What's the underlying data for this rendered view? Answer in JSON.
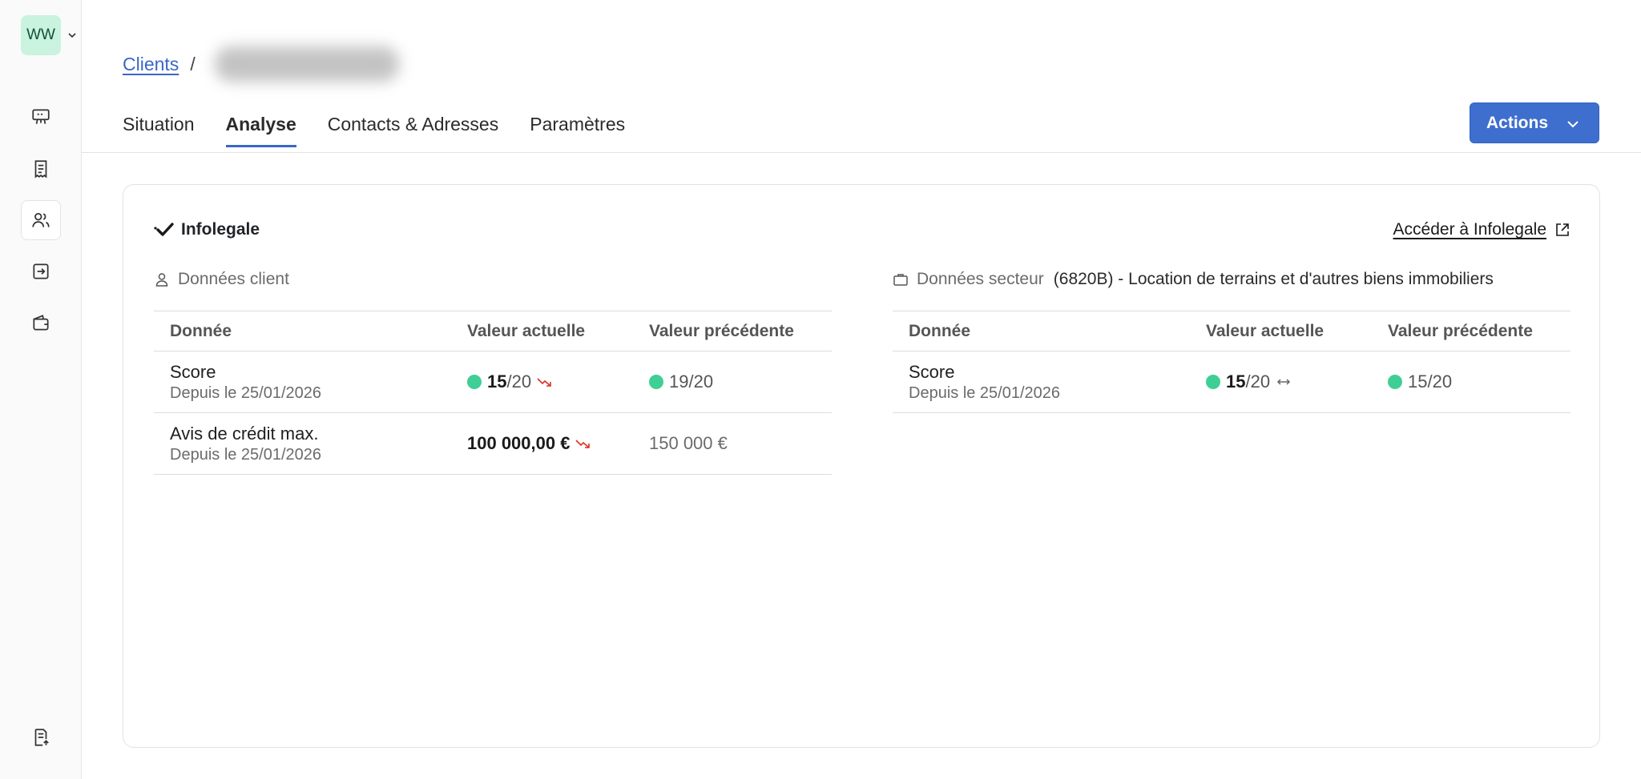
{
  "org": {
    "initials": "WW"
  },
  "breadcrumb": {
    "parent": "Clients",
    "separator": "/"
  },
  "tabs": [
    {
      "label": "Situation"
    },
    {
      "label": "Analyse"
    },
    {
      "label": "Contacts & Adresses"
    },
    {
      "label": "Paramètres"
    }
  ],
  "actions_label": "Actions",
  "card": {
    "title": "Infolegale",
    "external_link": "Accéder à Infolegale"
  },
  "client": {
    "heading": "Données client",
    "headers": [
      "Donnée",
      "Valeur actuelle",
      "Valeur précédente"
    ],
    "rows": [
      {
        "label": "Score",
        "since": "Depuis le 25/01/2026",
        "current_main": "15",
        "current_suffix": "/20",
        "trend": "down",
        "previous": "19/20"
      },
      {
        "label": "Avis de crédit max.",
        "since": "Depuis le 25/01/2026",
        "current_main": "100 000,00 €",
        "trend": "down",
        "previous": "150 000 €"
      }
    ]
  },
  "sector": {
    "heading": "Données secteur",
    "code": "(6820B) - Location de terrains et d'autres biens immobiliers",
    "headers": [
      "Donnée",
      "Valeur actuelle",
      "Valeur précédente"
    ],
    "rows": [
      {
        "label": "Score",
        "since": "Depuis le 25/01/2026",
        "current_main": "15",
        "current_suffix": "/20",
        "trend": "stable",
        "previous": "15/20"
      }
    ]
  },
  "colors": {
    "accent": "#3e6fcf",
    "score_dot": "#3fcf96",
    "trend_down": "#d93025"
  }
}
